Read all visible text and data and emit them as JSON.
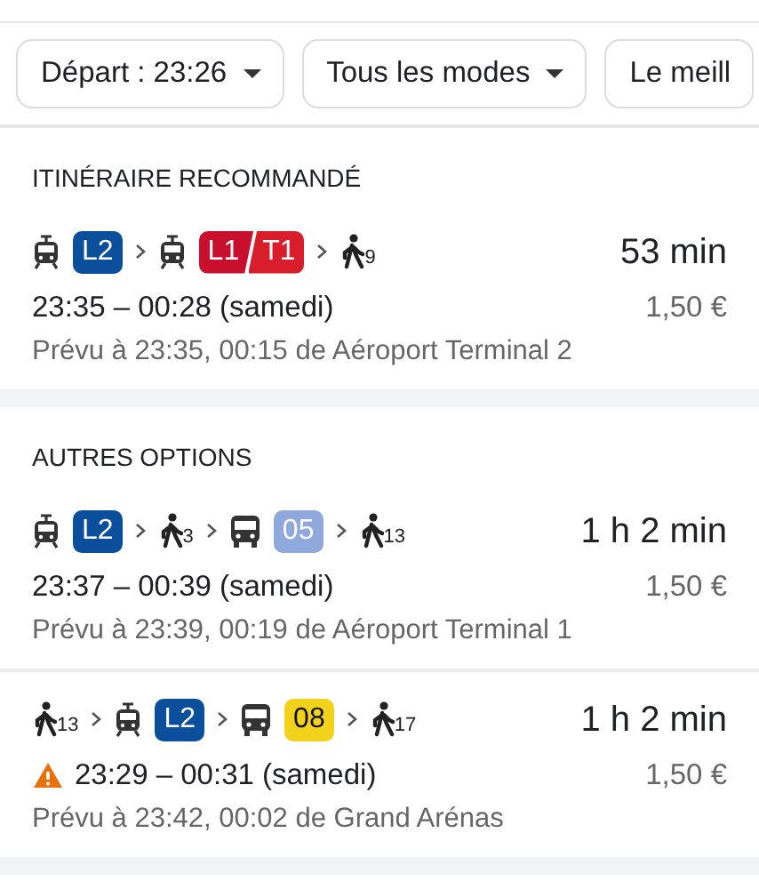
{
  "filters": [
    {
      "label": "Départ : 23:26",
      "dropdown": true
    },
    {
      "label": "Tous les modes",
      "dropdown": true
    },
    {
      "label": "Le meill",
      "dropdown": false
    }
  ],
  "sections": [
    {
      "title": "ITINÉRAIRE RECOMMANDÉ",
      "routes": [
        {
          "steps": [
            {
              "kind": "tram",
              "lines": [
                {
                  "label": "L2",
                  "color": "#0b4f9c"
                }
              ]
            },
            {
              "kind": "tram",
              "lines": [
                {
                  "label": "L1",
                  "color": "#c8102e"
                },
                {
                  "label": "T1",
                  "color": "#d81e2a"
                }
              ]
            },
            {
              "kind": "walk",
              "minutes": "9"
            }
          ],
          "duration": "53 min",
          "times": "23:35 – 00:28 (samedi)",
          "warning": false,
          "price": "1,50 €",
          "note": "Prévu à 23:35, 00:15 de Aéroport Terminal 2"
        }
      ]
    },
    {
      "title": "AUTRES OPTIONS",
      "routes": [
        {
          "steps": [
            {
              "kind": "tram",
              "lines": [
                {
                  "label": "L2",
                  "color": "#0b4f9c"
                }
              ]
            },
            {
              "kind": "walk",
              "minutes": "3"
            },
            {
              "kind": "bus",
              "lines": [
                {
                  "label": "05",
                  "color": "#8fa9dd"
                }
              ]
            },
            {
              "kind": "walk",
              "minutes": "13"
            }
          ],
          "duration": "1 h 2 min",
          "times": "23:37 – 00:39 (samedi)",
          "warning": false,
          "price": "1,50 €",
          "note": "Prévu à 23:39, 00:19 de Aéroport Terminal 1"
        },
        {
          "steps": [
            {
              "kind": "walk",
              "minutes": "13"
            },
            {
              "kind": "tram",
              "lines": [
                {
                  "label": "L2",
                  "color": "#0b4f9c"
                }
              ]
            },
            {
              "kind": "bus",
              "lines": [
                {
                  "label": "08",
                  "color": "#f3d21c"
                }
              ]
            },
            {
              "kind": "walk",
              "minutes": "17"
            }
          ],
          "duration": "1 h 2 min",
          "times": "23:29 – 00:31 (samedi)",
          "warning": true,
          "price": "1,50 €",
          "note": "Prévu à 23:42, 00:02 de Grand Arénas"
        }
      ]
    }
  ]
}
